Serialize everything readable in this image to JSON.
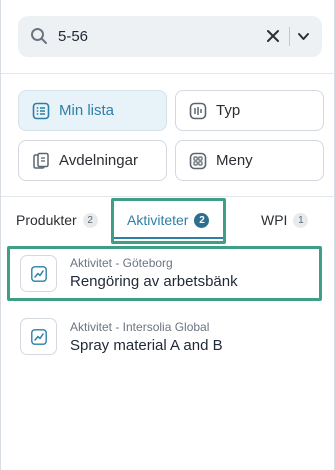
{
  "search": {
    "value": "5-56"
  },
  "filters": [
    {
      "label": "Min lista",
      "icon": "list-icon",
      "active": true
    },
    {
      "label": "Typ",
      "icon": "type-icon",
      "active": false
    },
    {
      "label": "Avdelningar",
      "icon": "departments-icon",
      "active": false
    },
    {
      "label": "Meny",
      "icon": "menu-grid-icon",
      "active": false
    }
  ],
  "tabs": [
    {
      "label": "Produkter",
      "count": "2",
      "active": false
    },
    {
      "label": "Aktiviteter",
      "count": "2",
      "active": true
    },
    {
      "label": "WPI",
      "count": "1",
      "active": false
    }
  ],
  "results": [
    {
      "meta": "Aktivitet - Göteborg",
      "title": "Rengöring av arbetsbänk",
      "icon": "activity-chart-icon",
      "highlighted": true
    },
    {
      "meta": "Aktivitet - Intersolia Global",
      "title": "Spray material A and B",
      "icon": "activity-chart-icon",
      "highlighted": false
    }
  ],
  "colors": {
    "accent": "#2d7fa6",
    "highlight": "#3f9f86",
    "active_bg": "#e8f3f9"
  }
}
